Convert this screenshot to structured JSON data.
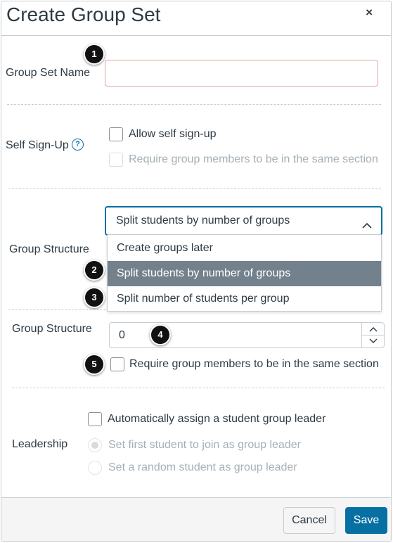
{
  "dialog": {
    "title": "Create Group Set",
    "close_symbol": "×"
  },
  "group_set_name": {
    "label": "Group Set Name",
    "value": "",
    "placeholder": ""
  },
  "self_signup": {
    "label": "Self Sign-Up",
    "help_symbol": "?",
    "allow_label": "Allow self sign-up",
    "require_section_label": "Require group members to be in the same section"
  },
  "group_structure": {
    "label": "Group Structure",
    "selected_value": "Split students by number of groups",
    "chevron": "^",
    "options": [
      "Create groups later",
      "Split students by number of groups",
      "Split number of students per group"
    ],
    "selected_index": 1
  },
  "group_count": {
    "label": "Group Structure",
    "value": "0",
    "up_symbol": "^",
    "down_symbol": "v",
    "require_section_label": "Require group members to be in the same section"
  },
  "leadership": {
    "label": "Leadership",
    "auto_assign_label": "Automatically assign a student group leader",
    "first_student_label": "Set first student to join as group leader",
    "random_student_label": "Set a random student as group leader"
  },
  "callouts": [
    "1",
    "2",
    "3",
    "4",
    "5"
  ],
  "footer": {
    "cancel_label": "Cancel",
    "save_label": "Save"
  },
  "colors": {
    "accent": "#0770a3",
    "selected_option_bg": "#73818c",
    "invalid_border": "#e8a1a1"
  },
  "icons": {
    "close": "close-icon",
    "help": "help-circle-icon",
    "chevron_up": "chevron-up-icon",
    "spin_up": "chevron-up-icon",
    "spin_down": "chevron-down-icon"
  }
}
